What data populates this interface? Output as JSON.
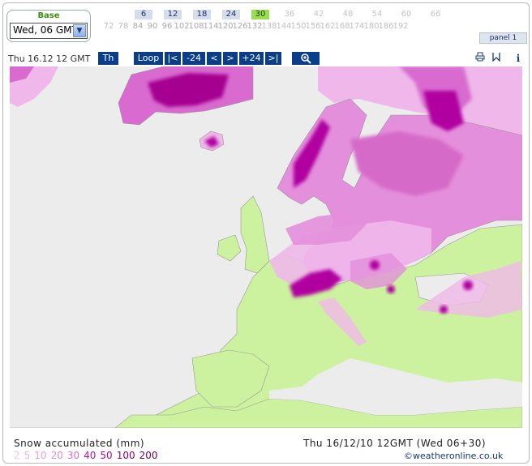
{
  "base": {
    "title": "Base",
    "selected": "Wed, 06 GMT"
  },
  "hours_top": [
    {
      "label": "6",
      "state": "active"
    },
    {
      "label": "12",
      "state": "active"
    },
    {
      "label": "18",
      "state": "active"
    },
    {
      "label": "24",
      "state": "active"
    },
    {
      "label": "30",
      "state": "current"
    },
    {
      "label": "36",
      "state": "disabled"
    },
    {
      "label": "42",
      "state": "disabled"
    },
    {
      "label": "48",
      "state": "disabled"
    },
    {
      "label": "54",
      "state": "disabled"
    },
    {
      "label": "60",
      "state": "disabled"
    },
    {
      "label": "66",
      "state": "disabled"
    }
  ],
  "hours_bottom": [
    "72",
    "78",
    "84",
    "90",
    "96",
    "102",
    "108",
    "114",
    "120",
    "126",
    "132",
    "138",
    "144",
    "150",
    "156",
    "162",
    "168",
    "174",
    "180",
    "186",
    "192"
  ],
  "panel": "panel 1",
  "toolbar": {
    "date": "Thu 16.12 12 GMT",
    "day_button": "Th",
    "loop": "Loop",
    "first": "|<",
    "minus24": "-24",
    "prev": "<",
    "next": ">",
    "plus24": "+24",
    "last": ">|",
    "zoom_icon": "magnifier-icon",
    "print_icon": "print-icon",
    "bookmark_icon": "bookmark-icon",
    "info_icon": "info-icon",
    "info_label": "i"
  },
  "legend": {
    "title": "Snow accumulated (mm)",
    "values": [
      {
        "v": "2",
        "color": "#f4c5ee"
      },
      {
        "v": "5",
        "color": "#eeb3e6"
      },
      {
        "v": "10",
        "color": "#e59cdc"
      },
      {
        "v": "20",
        "color": "#df8ad4"
      },
      {
        "v": "30",
        "color": "#d56ac8"
      },
      {
        "v": "40",
        "color": "#b9179f"
      },
      {
        "v": "50",
        "color": "#a8078c"
      },
      {
        "v": "100",
        "color": "#8a006f"
      },
      {
        "v": "200",
        "color": "#6b0057"
      }
    ]
  },
  "valid": "Thu 16/12/10 12GMT  (Wed 06+30)",
  "credit": "©weatheronline.co.uk",
  "colors": {
    "land": "#ccf2a0",
    "sea": "#ececec",
    "snow_light": "#f0b8ea",
    "snow_mid": "#e27ad8",
    "snow_heavy": "#b000a0",
    "button": "#0a3e8a"
  }
}
